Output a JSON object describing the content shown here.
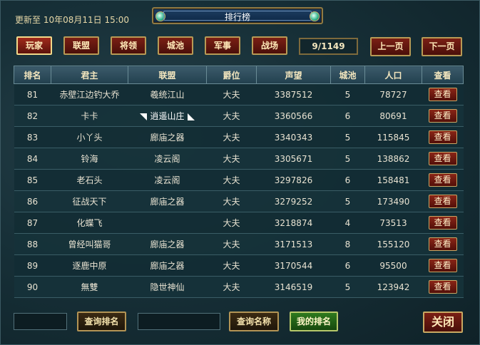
{
  "header": {
    "update_label": "更新至",
    "update_time": "10年08月11日 15:00",
    "title": "排行榜"
  },
  "tabs": [
    {
      "label": "玩家",
      "active": true
    },
    {
      "label": "联盟",
      "active": false
    },
    {
      "label": "将领",
      "active": false
    },
    {
      "label": "城池",
      "active": false
    },
    {
      "label": "军事",
      "active": false
    },
    {
      "label": "战场",
      "active": false
    }
  ],
  "pagination": {
    "page_indicator": "9/1149",
    "prev_label": "上一页",
    "next_label": "下一页"
  },
  "table": {
    "columns": [
      "排名",
      "君主",
      "联盟",
      "爵位",
      "声望",
      "城池",
      "人口",
      "查看"
    ],
    "view_label": "查看",
    "rows": [
      {
        "rank": "81",
        "lord": "赤壁江边钓大乔",
        "alliance": "羲统江山",
        "title": "大夫",
        "prestige": "3387512",
        "cities": "5",
        "population": "78727",
        "flag": false
      },
      {
        "rank": "82",
        "lord": "卡卡",
        "alliance": "逍遥山庄",
        "title": "大夫",
        "prestige": "3360566",
        "cities": "6",
        "population": "80691",
        "flag": true
      },
      {
        "rank": "83",
        "lord": "小丫头",
        "alliance": "廊庙之器",
        "title": "大夫",
        "prestige": "3340343",
        "cities": "5",
        "population": "115845",
        "flag": false
      },
      {
        "rank": "84",
        "lord": "铃海",
        "alliance": "凌云阁",
        "title": "大夫",
        "prestige": "3305671",
        "cities": "5",
        "population": "138862",
        "flag": false
      },
      {
        "rank": "85",
        "lord": "老石头",
        "alliance": "凌云阁",
        "title": "大夫",
        "prestige": "3297826",
        "cities": "6",
        "population": "158481",
        "flag": false
      },
      {
        "rank": "86",
        "lord": "征战天下",
        "alliance": "廊庙之器",
        "title": "大夫",
        "prestige": "3279252",
        "cities": "5",
        "population": "173490",
        "flag": false
      },
      {
        "rank": "87",
        "lord": "化蝶飞",
        "alliance": "",
        "title": "大夫",
        "prestige": "3218874",
        "cities": "4",
        "population": "73513",
        "flag": false
      },
      {
        "rank": "88",
        "lord": "曾经叫猫哥",
        "alliance": "廊庙之器",
        "title": "大夫",
        "prestige": "3171513",
        "cities": "8",
        "population": "155120",
        "flag": false
      },
      {
        "rank": "89",
        "lord": "逐鹿中原",
        "alliance": "廊庙之器",
        "title": "大夫",
        "prestige": "3170544",
        "cities": "6",
        "population": "95500",
        "flag": false
      },
      {
        "rank": "90",
        "lord": "無雙",
        "alliance": "隐世神仙",
        "title": "大夫",
        "prestige": "3146519",
        "cities": "5",
        "population": "123942",
        "flag": false
      }
    ]
  },
  "footer": {
    "search_rank_value": "",
    "search_rank_label": "查询排名",
    "search_name_value": "",
    "search_name_label": "查询名称",
    "my_rank_label": "我的排名",
    "close_label": "关闭"
  },
  "colors": {
    "button_red": "#7a1f14",
    "button_gold_border": "#b89a55",
    "my_rank_green": "#2f7a1e",
    "title_blue": "#1e3f63"
  }
}
